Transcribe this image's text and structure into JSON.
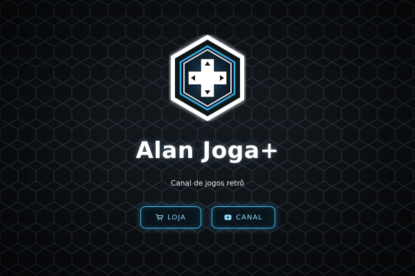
{
  "brand": {
    "title": "Alan Joga+",
    "subtitle": "Canal de jogos retrô",
    "logo_icon": "dpad-hexagon-logo"
  },
  "actions": {
    "store": {
      "label": "LOJA",
      "icon": "shopping-cart-icon"
    },
    "channel": {
      "label": "CANAL",
      "icon": "youtube-icon"
    }
  },
  "theme": {
    "background": "#0b0d10",
    "hex_grid": "#1f252c",
    "accent": "#42b8f0",
    "text": "#ffffff"
  }
}
